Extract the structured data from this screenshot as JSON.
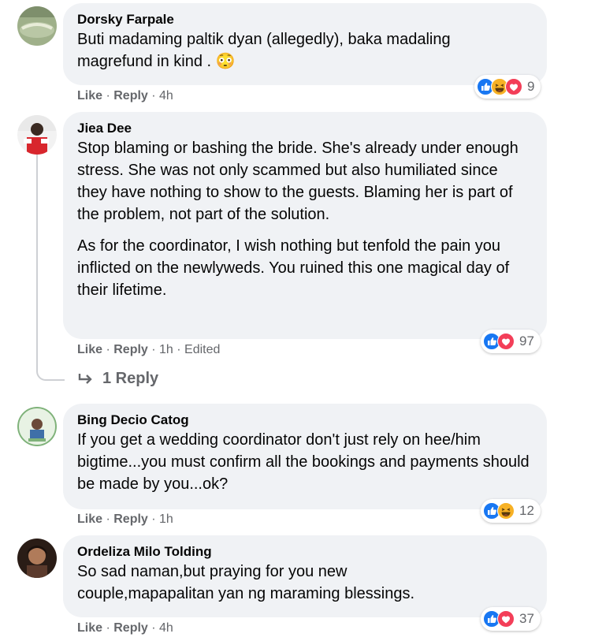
{
  "actions": {
    "like": "Like",
    "reply": "Reply",
    "sep": " · "
  },
  "comments": [
    {
      "author": "Dorsky Farpale",
      "paragraphs": [
        "Buti madaming paltik dyan (allegedly), baka madaling",
        "magrefund in kind . 😳"
      ],
      "time": "4h",
      "reactions": [
        "like-icon",
        "haha-icon",
        "love-icon"
      ],
      "reaction_count": "9"
    },
    {
      "author": "Jiea Dee",
      "paragraphs": [
        "Stop blaming or bashing the bride. She's already under enough stress. She was not only scammed but also humiliated since they have nothing to show to the guests. Blaming her is part of the problem, not part of the solution.",
        "As for the coordinator, I wish nothing but tenfold the pain you inflicted on the newlyweds. You ruined this one magical day of their lifetime."
      ],
      "time": "1h",
      "edited": "Edited",
      "reactions": [
        "like-icon",
        "love-icon"
      ],
      "reaction_count": "97",
      "replies_label": "1 Reply"
    },
    {
      "author": "Bing Decio Catog",
      "paragraphs": [
        "If you get a wedding coordinator don't just rely on hee/him bigtime...you must confirm all the bookings and payments should be made by you...ok?"
      ],
      "time": "1h",
      "reactions": [
        "like-icon",
        "haha-icon"
      ],
      "reaction_count": "12"
    },
    {
      "author": "Ordeliza Milo Tolding",
      "paragraphs": [
        "So sad naman,but praying for you new couple,mapapalitan yan ng maraming blessings."
      ],
      "time": "4h",
      "reactions": [
        "like-icon",
        "love-icon"
      ],
      "reaction_count": "37"
    }
  ]
}
